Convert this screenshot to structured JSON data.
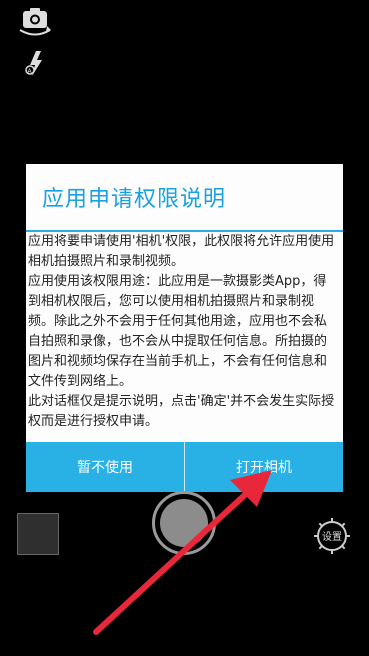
{
  "dialog": {
    "title": "应用申请权限说明",
    "body": "应用将要申请使用'相机'权限，此权限将允许应用使用相机拍摄照片和录制视频。\n应用使用该权限用途：此应用是一款摄影类App，得到相机权限后，您可以使用相机拍摄照片和录制视频。除此之外不会用于任何其他用途，应用也不会私自拍照和录像，也不会从中提取任何信息。所拍摄的图片和视频均保存在当前手机上，不会有任何信息和文件传到网络上。\n此对话框仅是提示说明，点击'确定'并不会发生实际授权而是进行授权申请。",
    "buttons": {
      "cancel": "暂不使用",
      "open_camera": "打开相机"
    }
  },
  "camera": {
    "settings_label": "设置"
  },
  "colors": {
    "accent": "#1aa1e1",
    "button_bg": "#29b1e6",
    "arrow": "#e8283a"
  },
  "icons": [
    "switch-camera-icon",
    "flash-auto-icon",
    "gear-icon"
  ]
}
